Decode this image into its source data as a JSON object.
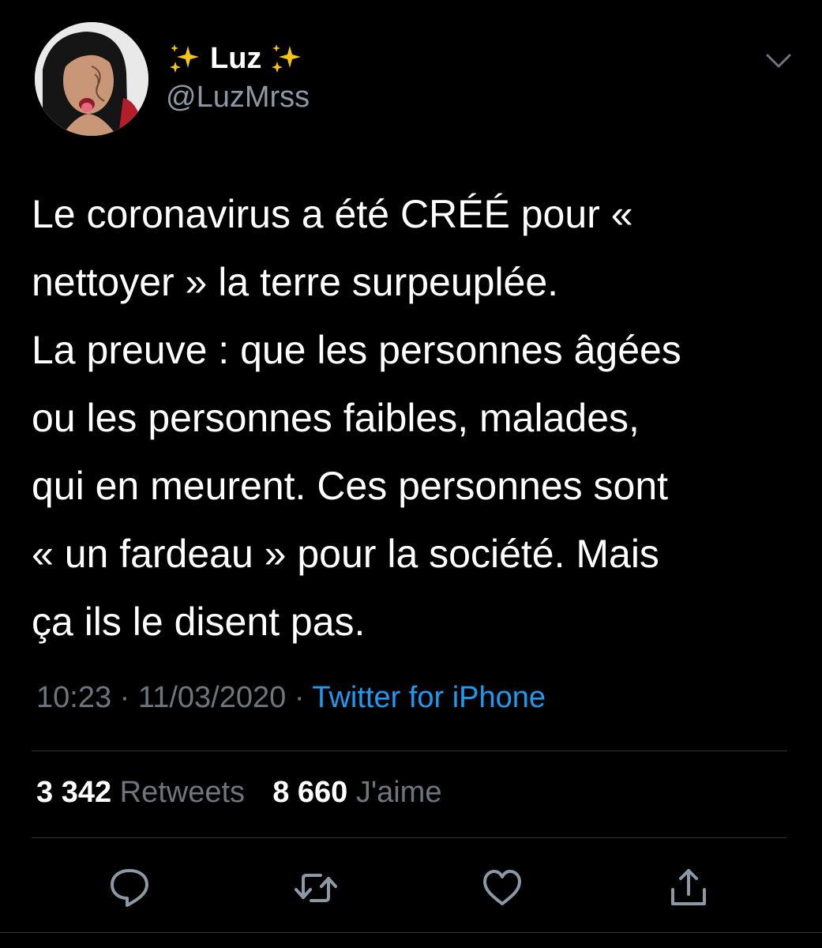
{
  "author": {
    "display_name": "Luz",
    "handle": "@LuzMrss",
    "name_decoration": "sparkles"
  },
  "tweet": {
    "lines": [
      "Le coronavirus a été CRÉÉ pour «",
      "nettoyer » la terre surpeuplée.",
      "La preuve : que les personnes âgées",
      "ou les personnes faibles, malades,",
      "qui en meurent. Ces personnes sont",
      "«  un fardeau » pour la société. Mais",
      "ça ils le disent pas."
    ],
    "time": "10:23",
    "date": "11/03/2020",
    "separator": "·",
    "source": "Twitter for iPhone"
  },
  "stats": {
    "retweets_count": "3 342",
    "retweets_label": "Retweets",
    "likes_count": "8 660",
    "likes_label": "J'aime"
  },
  "icons": {
    "menu": "chevron-down-icon",
    "reply": "reply-icon",
    "retweet": "retweet-icon",
    "like": "heart-icon",
    "share": "share-icon"
  },
  "colors": {
    "background": "#000000",
    "text": "#ffffff",
    "secondary_text": "#8b98a5",
    "link": "#1d9bf0",
    "divider": "#2f3336",
    "icon": "#8b98a5"
  }
}
